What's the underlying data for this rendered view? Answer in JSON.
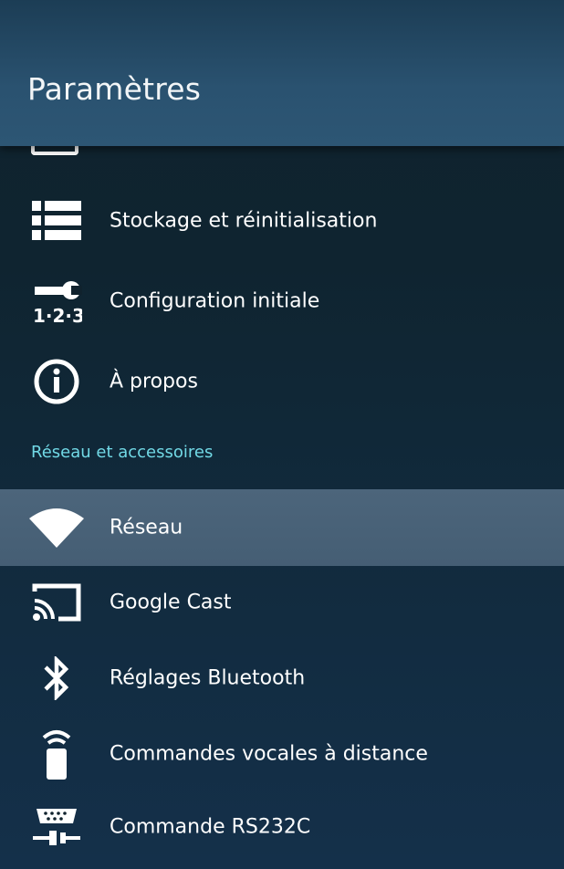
{
  "header": {
    "title": "Paramètres"
  },
  "items": [
    {
      "label": "Stockage et réinitialisation",
      "icon": "storage-icon"
    },
    {
      "label": "Configuration initiale",
      "icon": "setup-wrench-123-icon"
    },
    {
      "label": "À propos",
      "icon": "info-icon"
    }
  ],
  "section": {
    "title": "Réseau et accessoires"
  },
  "network_items": [
    {
      "label": "Réseau",
      "icon": "wifi-icon",
      "selected": true
    },
    {
      "label": "Google Cast",
      "icon": "cast-icon"
    },
    {
      "label": "Réglages Bluetooth",
      "icon": "bluetooth-icon"
    },
    {
      "label": "Commandes vocales à distance",
      "icon": "remote-voice-icon"
    },
    {
      "label": "Commande RS232C",
      "icon": "rs232c-icon"
    }
  ],
  "colors": {
    "accent": "#71d9e6",
    "selected_row": "#4c657b",
    "header_bg": "#2a5270",
    "body_bg": "#10222d"
  }
}
